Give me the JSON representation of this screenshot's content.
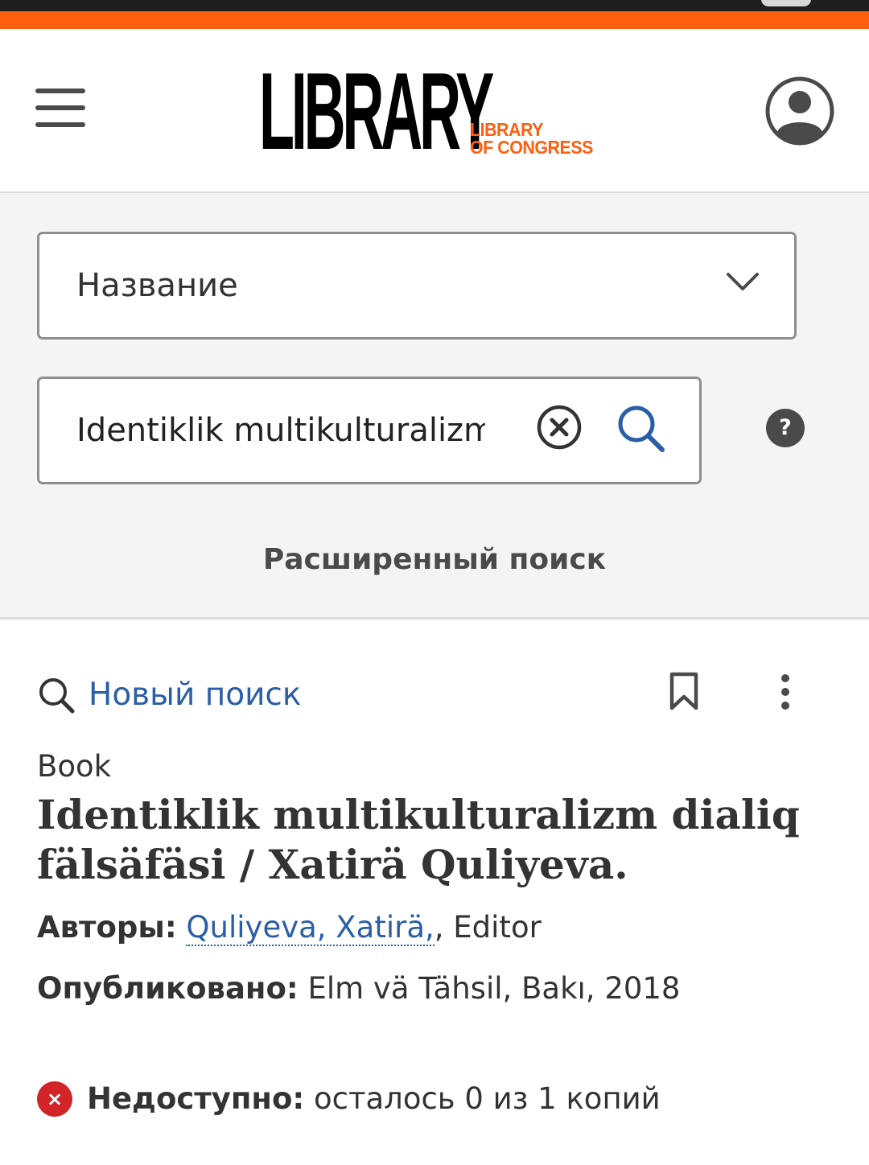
{
  "colors": {
    "accent": "#ff5f0f",
    "link": "#2a5ea6",
    "unavailable": "#d32528",
    "text": "#333333",
    "panel_background": "#f4f4f4"
  },
  "header": {
    "menu_icon": "hamburger-menu-icon",
    "logo": {
      "main": "LIBRARY",
      "sub_line1": "LIBRARY",
      "sub_line2": "OF CONGRESS"
    },
    "account_icon": "user-account-icon"
  },
  "search": {
    "field_select": {
      "selected": "Название",
      "icon": "chevron-down-icon"
    },
    "query": "Identiklik multikulturalizm",
    "clear_icon": "clear-circle-x-icon",
    "search_icon": "search-icon",
    "help_label": "?",
    "advanced_label": "Расширенный поиск"
  },
  "toolbar": {
    "new_search_label": "Новый поиск",
    "bookmark_icon": "bookmark-icon",
    "more_icon": "more-vertical-icon"
  },
  "record": {
    "format": "Book",
    "title": "Identiklik multikulturalizm dialiq fälsäfäsi / Xatirä Quliyeva.",
    "authors_label": "Авторы:",
    "author_name": "Quliyeva, Xatirä,",
    "author_role": ", Editor",
    "published_label": "Опубликовано:",
    "published_value": "Elm vä Tähsil, Bakı, 2018"
  },
  "availability": {
    "icon": "unavailable-x-icon",
    "icon_glyph": "×",
    "label": "Недоступно:",
    "detail": "осталось 0 из 1 копий"
  }
}
